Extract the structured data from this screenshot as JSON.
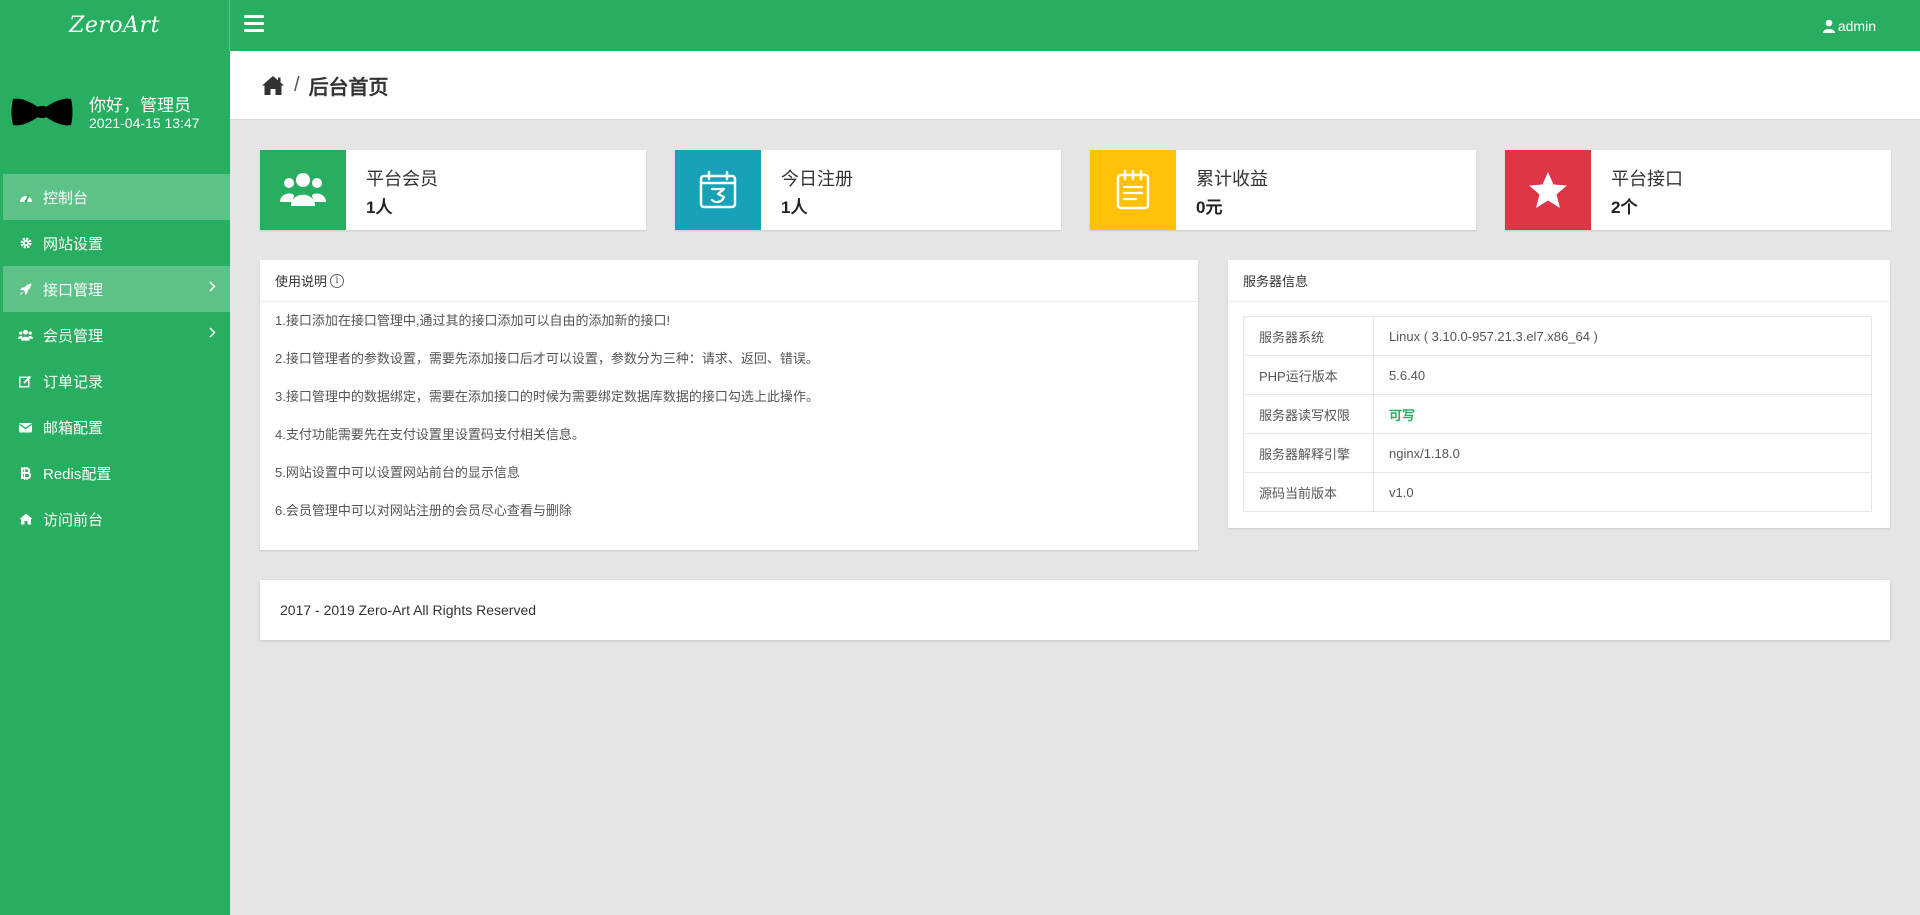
{
  "topbar": {
    "logo": "ZeroArt",
    "user": "admin",
    "colors": {
      "primary": "#27ae60"
    }
  },
  "sidebar": {
    "greeting": "你好，管理员",
    "datetime": "2021-04-15 13:47",
    "items": [
      {
        "label": "控制台",
        "icon": "dashboard-icon"
      },
      {
        "label": "网站设置",
        "icon": "gear-icon"
      },
      {
        "label": "接口管理",
        "icon": "rocket-icon"
      },
      {
        "label": "会员管理",
        "icon": "users-icon"
      },
      {
        "label": "订单记录",
        "icon": "edit-icon"
      },
      {
        "label": "邮箱配置",
        "icon": "envelope-icon"
      },
      {
        "label": "Redis配置",
        "icon": "bitcoin-icon"
      },
      {
        "label": "访问前台",
        "icon": "home-icon"
      }
    ]
  },
  "header": {
    "separator": "/",
    "title": "后台首页"
  },
  "stats": [
    {
      "label": "平台会员",
      "value": "1人",
      "color": "#27ae60",
      "icon": "users-icon"
    },
    {
      "label": "今日注册",
      "value": "1人",
      "color": "#17a2b8",
      "icon": "calendar-icon"
    },
    {
      "label": "累计收益",
      "value": "0元",
      "color": "#ffc107",
      "icon": "notepad-icon"
    },
    {
      "label": "平台接口",
      "value": "2个",
      "color": "#dc3545",
      "icon": "star-icon"
    }
  ],
  "usage": {
    "title": "使用说明",
    "info": "i",
    "lines": [
      "1.接口添加在接口管理中,通过其的接口添加可以自由的添加新的接口!",
      "2.接口管理者的参数设置，需要先添加接口后才可以设置，参数分为三种：请求、返回、错误。",
      "3.接口管理中的数据绑定，需要在添加接口的时候为需要绑定数据库数据的接口勾选上此操作。",
      "4.支付功能需要先在支付设置里设置码支付相关信息。",
      "5.网站设置中可以设置网站前台的显示信息",
      "6.会员管理中可以对网站注册的会员尽心查看与删除"
    ]
  },
  "server": {
    "title": "服务器信息",
    "rows": [
      {
        "key": "服务器系统",
        "value": "Linux ( 3.10.0-957.21.3.el7.x86_64 )"
      },
      {
        "key": "PHP运行版本",
        "value": "5.6.40"
      },
      {
        "key": "服务器读写权限",
        "value": "可写"
      },
      {
        "key": "服务器解释引擎",
        "value": "nginx/1.18.0"
      },
      {
        "key": "源码当前版本",
        "value": "v1.0"
      }
    ]
  },
  "footer": {
    "text": "2017 - 2019 Zero-Art All Rights Reserved"
  }
}
